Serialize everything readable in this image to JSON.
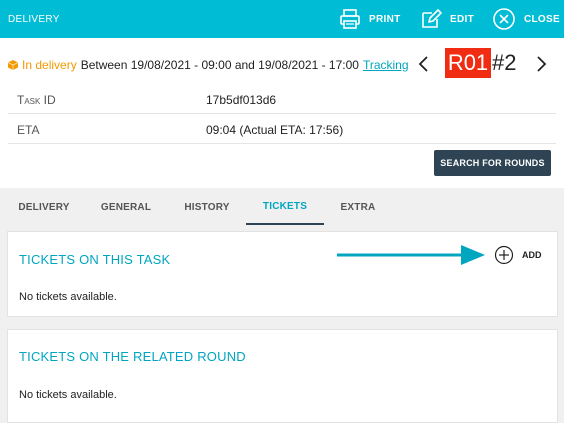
{
  "topbar": {
    "title": "DELIVERY",
    "print_label": "PRINT",
    "edit_label": "EDIT",
    "close_label": "CLOSE",
    "bg_color": "#00bcd4"
  },
  "header": {
    "status": "In delivery",
    "status_color": "#f29a00",
    "window_text": "Between 19/08/2021 - 09:00 and 19/08/2021 - 17:00",
    "tracking_label": "Tracking",
    "route_code": "R01",
    "route_color": "#f02d12",
    "stop_number": "#2",
    "fields": [
      {
        "label": "Task ID",
        "value": "17b5df013d6"
      },
      {
        "label": "ETA",
        "value": "09:04 (Actual ETA: 17:56)"
      }
    ],
    "search_button": "SEARCH FOR ROUNDS"
  },
  "tabs": [
    {
      "label": "DELIVERY",
      "active": false
    },
    {
      "label": "GENERAL",
      "active": false
    },
    {
      "label": "HISTORY",
      "active": false
    },
    {
      "label": "TICKETS",
      "active": true
    },
    {
      "label": "EXTRA",
      "active": false
    }
  ],
  "tickets_task": {
    "title": "TICKETS ON THIS TASK",
    "add_label": "ADD",
    "empty_text": "No tickets available."
  },
  "tickets_round": {
    "title": "TICKETS ON THE RELATED ROUND",
    "empty_text": "No tickets available."
  },
  "icons": {
    "print": "printer-icon",
    "edit": "edit-icon",
    "close": "close-circle-icon",
    "status": "box-icon",
    "prev": "chevron-left-icon",
    "next": "chevron-right-icon",
    "add": "plus-circle-icon",
    "annotation": "arrow-right-icon"
  },
  "accent_color": "#00a6c0"
}
